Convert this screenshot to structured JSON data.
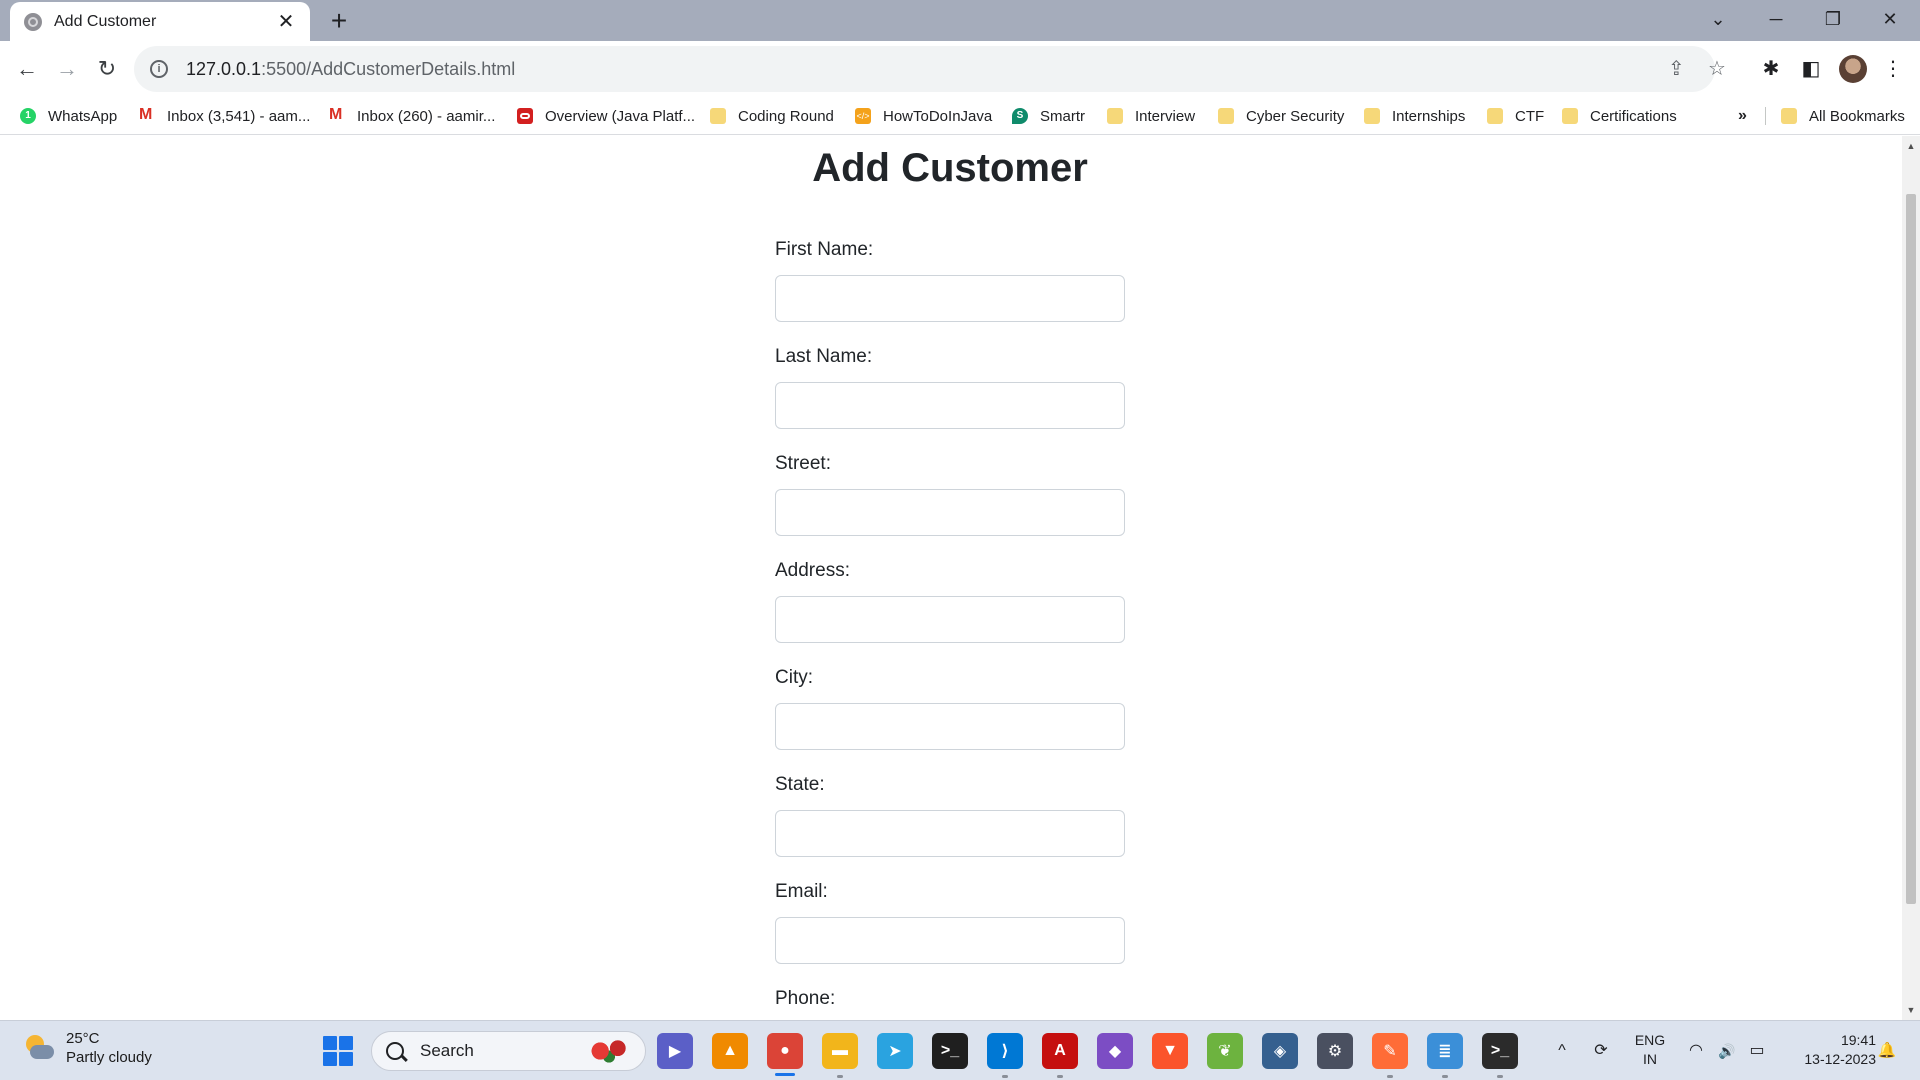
{
  "browser": {
    "tab": {
      "title": "Add Customer",
      "close_glyph": "✕"
    },
    "new_tab_glyph": "+",
    "window_controls": {
      "dropdown": "⌄",
      "minimize": "─",
      "restore": "❐",
      "close": "✕"
    },
    "toolbar": {
      "back": "←",
      "forward": "→",
      "reload": "↻",
      "url_host": "127.0.0.1",
      "url_path": ":5500/AddCustomerDetails.html",
      "info_glyph": "i",
      "share_glyph": "⇪",
      "star_glyph": "☆",
      "extensions_glyph": "✱",
      "sidepanel_glyph": "◧",
      "menu_glyph": "⋮"
    },
    "bookmarks": [
      {
        "label": "WhatsApp",
        "icon": "whatsapp-icon",
        "glyph": "1"
      },
      {
        "label": "Inbox (3,541) - aam...",
        "icon": "gmail-icon",
        "glyph": ""
      },
      {
        "label": "Inbox (260) - aamir...",
        "icon": "gmail-icon",
        "glyph": ""
      },
      {
        "label": "Overview (Java Platf...",
        "icon": "oracle-icon",
        "glyph": ""
      },
      {
        "label": "Coding Round",
        "icon": "folder-icon",
        "glyph": ""
      },
      {
        "label": "HowToDoInJava",
        "icon": "howtodoinjava-icon",
        "glyph": "</>"
      },
      {
        "label": "Smartr",
        "icon": "smartr-icon",
        "glyph": "S"
      },
      {
        "label": "Interview",
        "icon": "folder-icon",
        "glyph": ""
      },
      {
        "label": "Cyber Security",
        "icon": "folder-icon",
        "glyph": ""
      },
      {
        "label": "Internships",
        "icon": "folder-icon",
        "glyph": ""
      },
      {
        "label": "CTF",
        "icon": "folder-icon",
        "glyph": ""
      },
      {
        "label": "Certifications",
        "icon": "folder-icon",
        "glyph": ""
      }
    ],
    "bookmarks_more": "»",
    "all_bookmarks": "All Bookmarks"
  },
  "page": {
    "title": "Add Customer",
    "fields": [
      {
        "label": "First Name:",
        "value": ""
      },
      {
        "label": "Last Name:",
        "value": ""
      },
      {
        "label": "Street:",
        "value": ""
      },
      {
        "label": "Address:",
        "value": ""
      },
      {
        "label": "City:",
        "value": ""
      },
      {
        "label": "State:",
        "value": ""
      },
      {
        "label": "Email:",
        "value": ""
      },
      {
        "label": "Phone:",
        "value": ""
      }
    ]
  },
  "taskbar": {
    "weather": {
      "temp": "25°C",
      "condition": "Partly cloudy"
    },
    "search_placeholder": "Search",
    "apps": [
      {
        "name": "zoom-icon",
        "glyph": "▶",
        "color": "#5b5fc7"
      },
      {
        "name": "vlc-icon",
        "glyph": "▲",
        "color": "#f08a00"
      },
      {
        "name": "chrome-icon",
        "glyph": "●",
        "color": "#db4437"
      },
      {
        "name": "file-explorer-icon",
        "glyph": "▬",
        "color": "#f2b51b"
      },
      {
        "name": "telegram-icon",
        "glyph": "➤",
        "color": "#2aa3e0"
      },
      {
        "name": "terminal-icon",
        "glyph": ">_",
        "color": "#1f1f1f"
      },
      {
        "name": "vscode-icon",
        "glyph": "⟩",
        "color": "#0078d4"
      },
      {
        "name": "acrobat-icon",
        "glyph": "A",
        "color": "#c50f0f"
      },
      {
        "name": "visual-studio-icon",
        "glyph": "◆",
        "color": "#7c4dc4"
      },
      {
        "name": "brave-icon",
        "glyph": "▼",
        "color": "#fb542b"
      },
      {
        "name": "spring-icon",
        "glyph": "❦",
        "color": "#6db33f"
      },
      {
        "name": "sql-server-icon",
        "glyph": "◈",
        "color": "#35608f"
      },
      {
        "name": "settings-icon",
        "glyph": "⚙",
        "color": "#4a5060"
      },
      {
        "name": "postman-icon",
        "glyph": "✎",
        "color": "#ff6c37"
      },
      {
        "name": "notepad-icon",
        "glyph": "≣",
        "color": "#3b8fd8"
      },
      {
        "name": "windows-terminal-icon",
        "glyph": ">_",
        "color": "#2b2b2b"
      }
    ],
    "tray": {
      "chevron": "^",
      "sync": "⟳",
      "wifi": "◠",
      "volume": "🔊",
      "battery": "▭",
      "notification": "🔔"
    },
    "language": {
      "line1": "ENG",
      "line2": "IN"
    },
    "clock": {
      "time": "19:41",
      "date": "13-12-2023"
    }
  }
}
